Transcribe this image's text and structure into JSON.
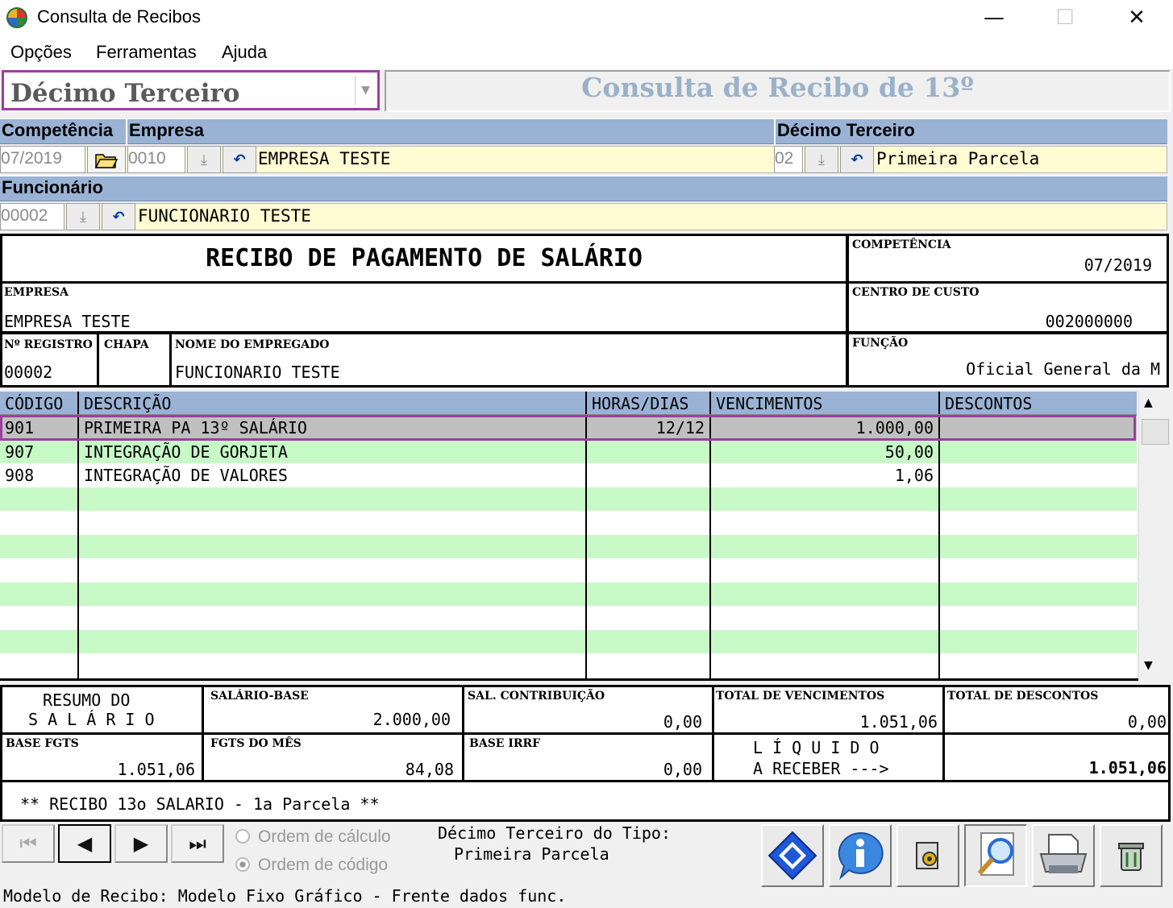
{
  "window": {
    "title": "Consulta de Recibos",
    "minimize": "—",
    "maximize": "☐",
    "close": "✕"
  },
  "menu": [
    "Opções",
    "Ferramentas",
    "Ajuda"
  ],
  "combo": {
    "value": "Décimo Terceiro"
  },
  "header": {
    "title": "Consulta de Recibo de 13º"
  },
  "filters": {
    "competencia_label": "Competência",
    "competencia_value": "07/2019",
    "empresa_label": "Empresa",
    "empresa_code": "0010",
    "empresa_name": "EMPRESA TESTE",
    "decimo_label": "Décimo Terceiro",
    "decimo_code": "02",
    "decimo_name": "Primeira Parcela",
    "funcionario_label": "Funcionário",
    "funcionario_code": "00002",
    "funcionario_name": "FUNCIONARIO TESTE"
  },
  "receipt": {
    "title": "RECIBO DE PAGAMENTO DE SALÁRIO",
    "competencia_label": "COMPETÊNCIA",
    "competencia_value": "07/2019",
    "empresa_label": "EMPRESA",
    "empresa_value": "EMPRESA TESTE",
    "centro_label": "CENTRO DE CUSTO",
    "centro_value": "002000000",
    "registro_label": "Nº REGISTRO",
    "registro_value": "00002",
    "chapa_label": "CHAPA",
    "nome_label": "NOME DO EMPREGADO",
    "nome_value": "FUNCIONARIO TESTE",
    "funcao_label": "FUNÇÃO",
    "funcao_value": "Oficial General da M"
  },
  "grid": {
    "headers": [
      "CÓDIGO",
      "DESCRIÇÃO",
      "HORAS/DIAS",
      "VENCIMENTOS",
      "DESCONTOS"
    ],
    "rows": [
      {
        "codigo": "901",
        "descricao": "PRIMEIRA PA 13º SALÁRIO",
        "horas": "12/12",
        "vencimentos": "1.000,00",
        "descontos": ""
      },
      {
        "codigo": "907",
        "descricao": "INTEGRAÇÃO DE GORJETA",
        "horas": "",
        "vencimentos": "50,00",
        "descontos": ""
      },
      {
        "codigo": "908",
        "descricao": "INTEGRAÇÃO DE VALORES",
        "horas": "",
        "vencimentos": "1,06",
        "descontos": ""
      }
    ],
    "selected_row": 0
  },
  "summary": {
    "resumo_line1": "RESUMO DO",
    "resumo_line2": "S A L Á R I O",
    "salario_base_label": "SALÁRIO-BASE",
    "salario_base_value": "2.000,00",
    "sal_contrib_label": "SAL. CONTRIBUIÇÃO",
    "sal_contrib_value": "0,00",
    "total_venc_label": "TOTAL DE VENCIMENTOS",
    "total_venc_value": "1.051,06",
    "total_desc_label": "TOTAL DE DESCONTOS",
    "total_desc_value": "0,00",
    "base_fgts_label": "BASE FGTS",
    "base_fgts_value": "1.051,06",
    "fgts_mes_label": "FGTS DO MÊS",
    "fgts_mes_value": "84,08",
    "base_irrf_label": "BASE IRRF",
    "base_irrf_value": "0,00",
    "liquido_line1": "L Í Q U I D O",
    "liquido_line2": "A RECEBER --->",
    "liquido_value": "1.051,06",
    "message": "** RECIBO 13o SALARIO - 1a Parcela **"
  },
  "footer": {
    "radio_calculo": "Ordem de cálculo",
    "radio_codigo": "Ordem de código",
    "tipo_line1": "Décimo Terceiro do Tipo:",
    "tipo_line2": "Primeira Parcela",
    "modelo": "Modelo de Recibo: Modelo Fixo Gráfico - Frente dados func."
  }
}
